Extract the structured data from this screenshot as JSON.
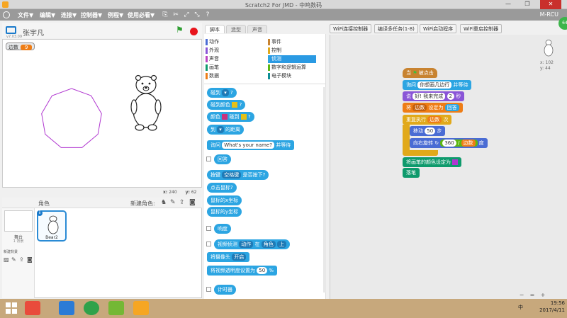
{
  "window": {
    "title": "Scratch2 For JMD - 中鸣数码"
  },
  "menu": {
    "items": [
      "文件▼",
      "编辑▼",
      "连接▼",
      "控制器▼",
      "例程▼",
      "使用必看▼"
    ],
    "right_label": "M-RCU"
  },
  "stage_header": {
    "sprite_name": "张宇凡",
    "version": "v7.03.09"
  },
  "stage": {
    "variable_name": "边数",
    "variable_value": "9",
    "x_label": "x:",
    "x_value": "240",
    "y_label": "y:",
    "y_value": "62",
    "polygon_sides": 9,
    "polygon_color": "#b036d0"
  },
  "sprites_pane": {
    "title": "角色",
    "new_sprite_label": "新建角色:",
    "stage_label": "舞台",
    "stage_sub": "1 背景",
    "new_backdrop_label": "新建背景",
    "sprite_tile_name": "Bear2"
  },
  "tabs": [
    "脚本",
    "造型",
    "声音"
  ],
  "categories": {
    "left": [
      {
        "label": "动作",
        "color": "#4a6cd4"
      },
      {
        "label": "外观",
        "color": "#8a55d7"
      },
      {
        "label": "声音",
        "color": "#bb42c3"
      },
      {
        "label": "画笔",
        "color": "#0e9a6c"
      },
      {
        "label": "数据",
        "color": "#ee7d16"
      }
    ],
    "right": [
      {
        "label": "事件",
        "color": "#c88330"
      },
      {
        "label": "控制",
        "color": "#e1a91a"
      },
      {
        "label": "侦测",
        "color": "#2ca5e2"
      },
      {
        "label": "数字和逻辑运算",
        "color": "#5cb712"
      },
      {
        "label": "电子模块",
        "color": "#0e8f96"
      }
    ]
  },
  "palette": {
    "touching": "碰到",
    "touching_color": "碰到颜色",
    "color_touching_a": "颜色",
    "color_touching_b": "碰到",
    "distance_a": "到",
    "distance_b": "的距离",
    "ask_a": "询问",
    "ask_value": "What's your name?",
    "ask_b": "并等待",
    "answer": "回答",
    "key_a": "按键",
    "key_value": "空格键",
    "key_b": "是否按下?",
    "mouse_down": "点击鼠标?",
    "mouse_x": "鼠标的x坐标",
    "mouse_y": "鼠标的y坐标",
    "loudness": "响度",
    "video_a": "视频侦测",
    "video_value": "动作",
    "video_b": "在",
    "video_value2": "角色",
    "video_value3": "上",
    "camera_a": "将摄像头",
    "camera_value": "开启",
    "transparency_a": "将视频透明度设置为",
    "transparency_value": "50",
    "transparency_b": "%",
    "timer": "计时器"
  },
  "top_buttons": [
    "WiFi连接控制器",
    "编译多任务(1-8)",
    "WiFi启动程序",
    "WiFi重启控制器"
  ],
  "script": {
    "hat_a": "当",
    "hat_b": "被点击",
    "ask_a": "询问",
    "ask_value": "你想画几边行",
    "ask_b": "并等待",
    "say_a": "说",
    "say_value": "好! 我来完成",
    "say_secs": "2",
    "say_b": "秒",
    "set_a": "将",
    "set_var": "边数",
    "set_b": "设定为",
    "set_value": "回答",
    "repeat_a": "重复执行",
    "repeat_var": "边数",
    "repeat_b": "次",
    "move_a": "移动",
    "move_value": "50",
    "move_b": "步",
    "turn_a": "向右旋转",
    "turn_value": "360",
    "turn_div": "/",
    "turn_var": "边数",
    "turn_b": "度",
    "pen_color": "将画笔的颜色设定为",
    "pen_down": "落笔"
  },
  "sprite_info": {
    "x_label": "x:",
    "x_value": "102",
    "y_label": "y:",
    "y_value": "44"
  },
  "badge": "64",
  "taskbar": {
    "time": "19:56",
    "date": "2017/4/11",
    "ime": "中"
  }
}
